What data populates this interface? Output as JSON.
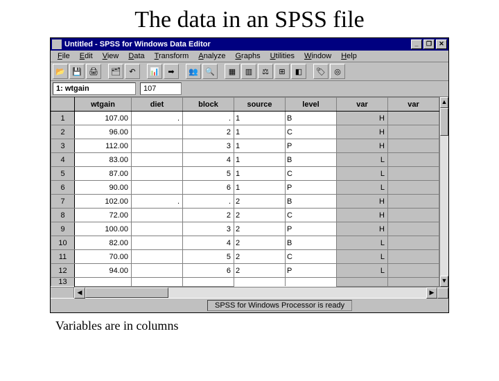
{
  "slide": {
    "title": "The data in an SPSS file",
    "caption": "Variables are in columns"
  },
  "window": {
    "doc": "Untitled",
    "app": "SPSS for Windows Data Editor",
    "sep": " - "
  },
  "menu": [
    "File",
    "Edit",
    "View",
    "Data",
    "Transform",
    "Analyze",
    "Graphs",
    "Utilities",
    "Window",
    "Help"
  ],
  "toolbar_icons": [
    "open",
    "save",
    "print",
    "|",
    "history",
    "undo",
    "|",
    "goto",
    "find",
    "|",
    "vars",
    "insert-case",
    "insert-var",
    "split",
    "weight",
    "select",
    "|",
    "value-labels",
    "sets"
  ],
  "cellbar": {
    "name": "1: wtgain",
    "value": "107"
  },
  "columns": [
    "wtgain",
    "diet",
    "block",
    "source",
    "level",
    "var",
    "var"
  ],
  "rows": [
    {
      "n": "1",
      "c": [
        "107.00",
        ".",
        ".",
        "1",
        "B",
        "H",
        "",
        ""
      ]
    },
    {
      "n": "2",
      "c": [
        "96.00",
        "",
        "2",
        "1",
        "C",
        "H",
        "",
        ""
      ]
    },
    {
      "n": "3",
      "c": [
        "112.00",
        "",
        "3",
        "1",
        "P",
        "H",
        "",
        ""
      ]
    },
    {
      "n": "4",
      "c": [
        "83.00",
        "",
        "4",
        "1",
        "B",
        "L",
        "",
        ""
      ]
    },
    {
      "n": "5",
      "c": [
        "87.00",
        "",
        "5",
        "1",
        "C",
        "L",
        "",
        ""
      ]
    },
    {
      "n": "6",
      "c": [
        "90.00",
        "",
        "6",
        "1",
        "P",
        "L",
        "",
        ""
      ]
    },
    {
      "n": "7",
      "c": [
        "102.00",
        ".",
        ".",
        "2",
        "B",
        "H",
        "",
        ""
      ]
    },
    {
      "n": "8",
      "c": [
        "72.00",
        "",
        "2",
        "2",
        "C",
        "H",
        "",
        ""
      ]
    },
    {
      "n": "9",
      "c": [
        "100.00",
        "",
        "3",
        "2",
        "P",
        "H",
        "",
        ""
      ]
    },
    {
      "n": "10",
      "c": [
        "82.00",
        "",
        "4",
        "2",
        "B",
        "L",
        "",
        ""
      ]
    },
    {
      "n": "11",
      "c": [
        "70.00",
        "",
        "5",
        "2",
        "C",
        "L",
        "",
        ""
      ]
    },
    {
      "n": "12",
      "c": [
        "94.00",
        "",
        "6",
        "2",
        "P",
        "L",
        "",
        ""
      ]
    },
    {
      "n": "13",
      "c": [
        "",
        "",
        "",
        "",
        "",
        "",
        "",
        ""
      ]
    }
  ],
  "status": "SPSS for Windows Processor is ready",
  "winbuttons": {
    "min": "_",
    "max": "❐",
    "close": "✕"
  },
  "scroll": {
    "up": "▲",
    "down": "▼",
    "left": "◀",
    "right": "▶"
  }
}
